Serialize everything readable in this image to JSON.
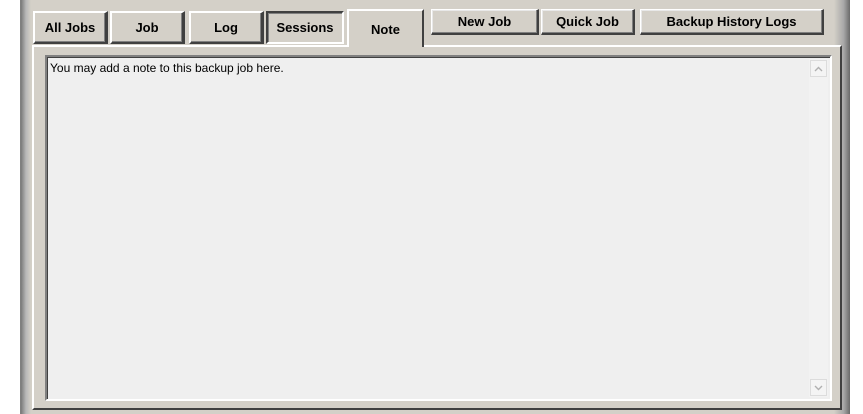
{
  "tabs": [
    {
      "label": "All Jobs",
      "state": "raised"
    },
    {
      "label": "Job",
      "state": "raised"
    },
    {
      "label": "Log",
      "state": "raised"
    },
    {
      "label": "Sessions",
      "state": "pressed"
    },
    {
      "label": "Note",
      "state": "active"
    }
  ],
  "toolbar": {
    "new_job": "New Job",
    "quick_job": "Quick Job",
    "history": "Backup History Logs"
  },
  "note": {
    "text": "You may add a note to this backup job here."
  },
  "icons": {
    "scroll_up": "chevron-up-icon",
    "scroll_down": "chevron-down-icon"
  }
}
